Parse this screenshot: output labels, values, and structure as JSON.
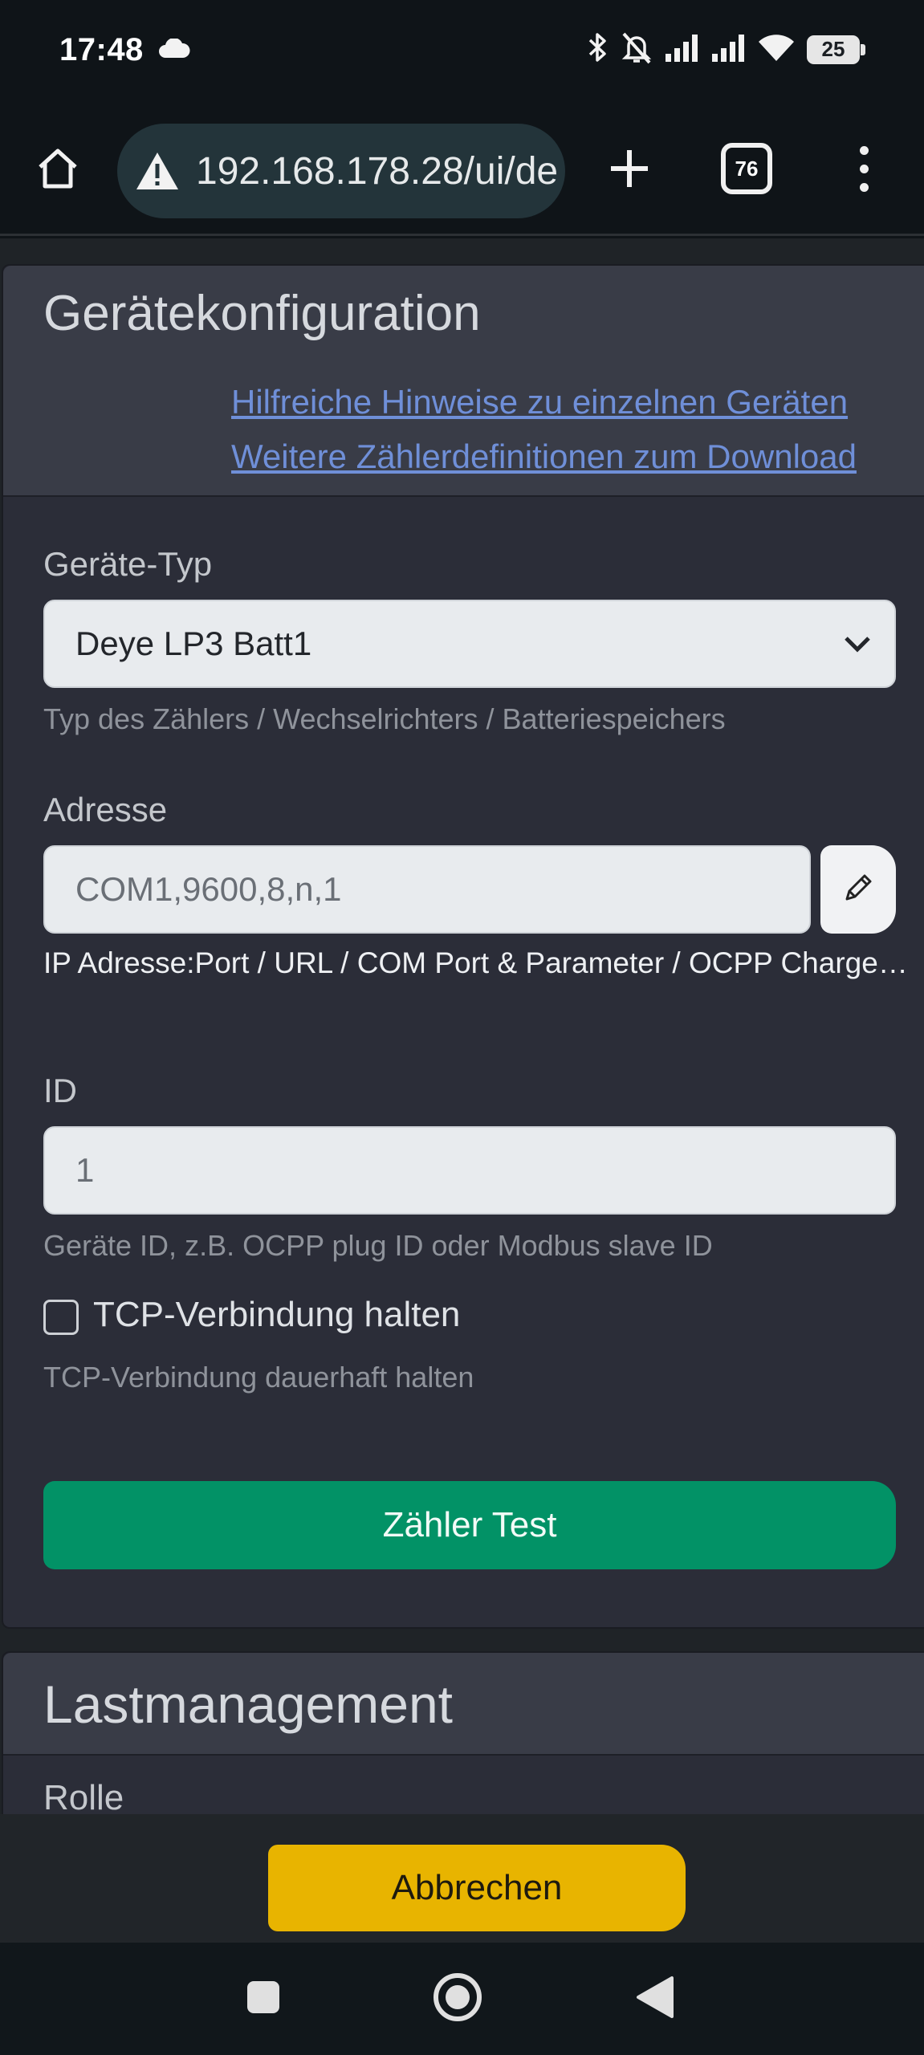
{
  "status_bar": {
    "time": "17:48",
    "weather_icon": "cloud-icon",
    "icons": [
      "bluetooth-icon",
      "bell-muted-icon",
      "signal-icon",
      "signal-icon",
      "wifi-icon"
    ],
    "battery_level": "25"
  },
  "browser": {
    "url": "192.168.178.28/ui/de",
    "security_icon": "warning-triangle-icon",
    "tab_count": "76"
  },
  "device_config": {
    "title": "Gerätekonfiguration",
    "links": [
      "Hilfreiche Hinweise zu einzelnen Geräten",
      "Weitere Zählerdefinitionen zum Download"
    ],
    "device_type": {
      "label": "Geräte-Typ",
      "selected": "Deye LP3 Batt1",
      "help": "Typ des Zählers / Wechselrichters / Batteriespeichers"
    },
    "address": {
      "label": "Adresse",
      "value": "COM1,9600,8,n,1",
      "hint": "IP Adresse:Port / URL / COM Port & Parameter / OCPP Charger ID"
    },
    "id": {
      "label": "ID",
      "value": "1",
      "help": "Geräte ID, z.B. OCPP plug ID oder Modbus slave ID"
    },
    "tcp_keep": {
      "label": "TCP-Verbindung halten",
      "help": "TCP-Verbindung dauerhaft halten",
      "checked": false
    },
    "test_button": "Zähler Test"
  },
  "load_management": {
    "title": "Lastmanagement",
    "next_label": "Rolle"
  },
  "actions": {
    "cancel": "Abbrechen"
  },
  "colors": {
    "accent_green": "#029266",
    "cancel_yellow": "#e8b400",
    "link_blue": "#6f8fd8"
  }
}
